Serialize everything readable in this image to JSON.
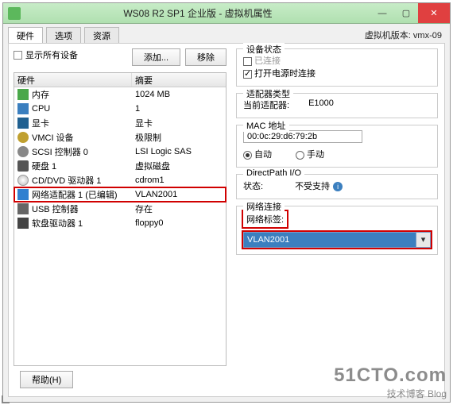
{
  "window": {
    "title": "WS08 R2 SP1 企业版 - 虚拟机属性",
    "min": "—",
    "max": "▢",
    "close": "✕"
  },
  "tabs": [
    "硬件",
    "选项",
    "资源"
  ],
  "vm_version_label": "虚拟机版本: vmx-09",
  "left": {
    "show_all_devices": "显示所有设备",
    "add_btn": "添加...",
    "remove_btn": "移除",
    "headers": {
      "hw": "硬件",
      "summary": "摘要"
    },
    "rows": [
      {
        "icon": "mem",
        "name": "内存",
        "summary": "1024 MB"
      },
      {
        "icon": "cpu",
        "name": "CPU",
        "summary": "1"
      },
      {
        "icon": "disp",
        "name": "显卡",
        "summary": "显卡"
      },
      {
        "icon": "vmci",
        "name": "VMCI 设备",
        "summary": "极限制"
      },
      {
        "icon": "scsi",
        "name": "SCSI 控制器 0",
        "summary": "LSI Logic SAS"
      },
      {
        "icon": "disk",
        "name": "硬盘 1",
        "summary": "虚拟磁盘"
      },
      {
        "icon": "cd",
        "name": "CD/DVD 驱动器 1",
        "summary": "cdrom1"
      },
      {
        "icon": "net",
        "name": "网络适配器 1 (已编辑)",
        "summary": "VLAN2001"
      },
      {
        "icon": "usb",
        "name": "USB 控制器",
        "summary": "存在"
      },
      {
        "icon": "floppy",
        "name": "软盘驱动器 1",
        "summary": "floppy0"
      }
    ]
  },
  "right": {
    "device_status": {
      "legend": "设备状态",
      "connected": "已连接",
      "power_on_connect": "打开电源时连接"
    },
    "adapter_type": {
      "legend": "适配器类型",
      "label": "当前适配器:",
      "value": "E1000"
    },
    "mac": {
      "legend": "MAC 地址",
      "value": "00:0c:29:d6:79:2b",
      "auto": "自动",
      "manual": "手动"
    },
    "directpath": {
      "legend": "DirectPath I/O",
      "label": "状态:",
      "value": "不受支持"
    },
    "netconn": {
      "legend": "网络连接",
      "label": "网络标签:",
      "value": "VLAN2001"
    }
  },
  "help_btn": "帮助(H)",
  "watermark": {
    "big": "51CTO.com",
    "small": "技术博客  Blog"
  }
}
